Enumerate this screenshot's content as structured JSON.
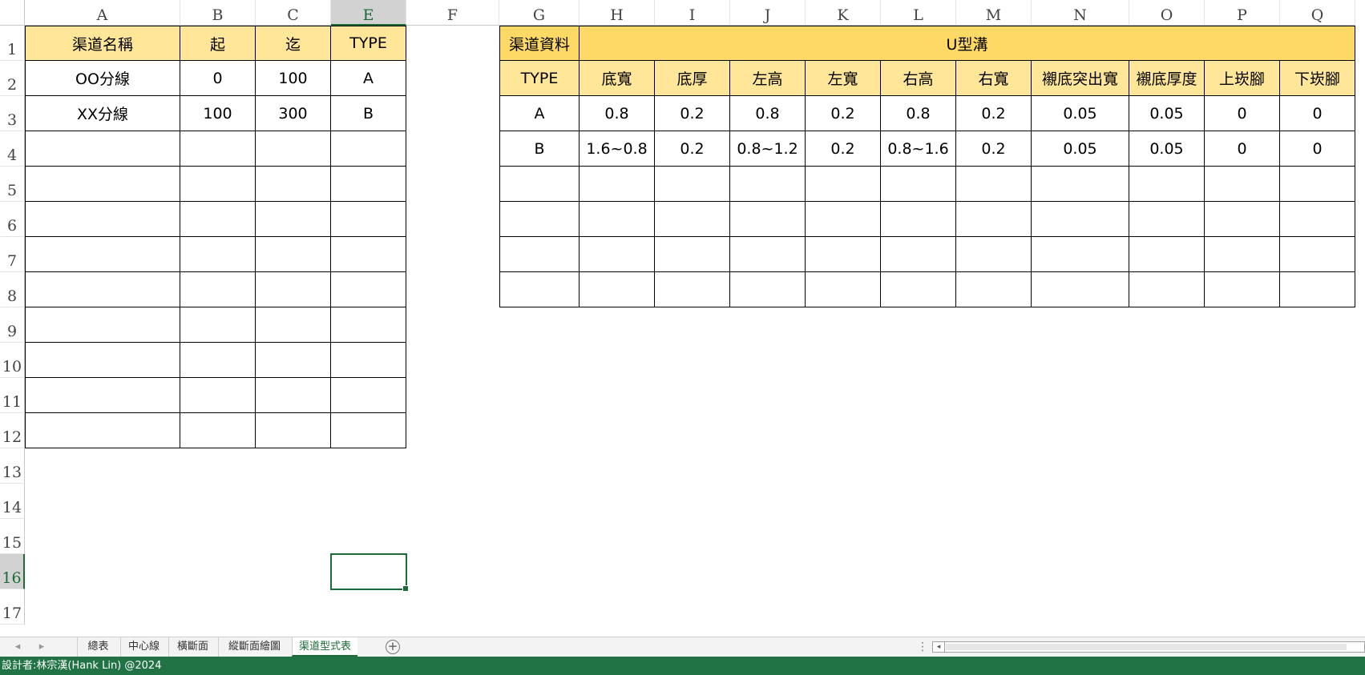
{
  "sheet": {
    "columns": [
      "A",
      "B",
      "C",
      "E",
      "F",
      "G",
      "H",
      "I",
      "J",
      "K",
      "L",
      "M",
      "N",
      "O",
      "P",
      "Q"
    ],
    "selected_column": "E",
    "rows": [
      "1",
      "2",
      "3",
      "4",
      "5",
      "6",
      "7",
      "8",
      "9",
      "10",
      "11",
      "12",
      "13",
      "14",
      "15",
      "16",
      "17"
    ],
    "selected_row": "16",
    "selected_cell": "E16"
  },
  "left_table": {
    "headers": [
      "渠道名稱",
      "起",
      "迄",
      "TYPE"
    ],
    "rows": [
      [
        "OO分線",
        "0",
        "100",
        "A"
      ],
      [
        "XX分線",
        "100",
        "300",
        "B"
      ]
    ]
  },
  "right_table": {
    "title_left": "渠道資料",
    "title_main": "U型溝",
    "headers": [
      "TYPE",
      "底寬",
      "底厚",
      "左高",
      "左寬",
      "右高",
      "右寬",
      "襯底突出寬",
      "襯底厚度",
      "上崁腳",
      "下崁腳"
    ],
    "rows": [
      [
        "A",
        "0.8",
        "0.2",
        "0.8",
        "0.2",
        "0.8",
        "0.2",
        "0.05",
        "0.05",
        "0",
        "0"
      ],
      [
        "B",
        "1.6~0.8",
        "0.2",
        "0.8~1.2",
        "0.2",
        "0.8~1.6",
        "0.2",
        "0.05",
        "0.05",
        "0",
        "0"
      ]
    ]
  },
  "tabs": {
    "items": [
      "總表",
      "中心線",
      "橫斷面",
      "縱斷面繪圖",
      "渠道型式表"
    ],
    "active": "渠道型式表"
  },
  "status": {
    "text": "設計者:林宗漢(Hank Lin) @2024"
  },
  "colors": {
    "header_fill_light": "#ffe699",
    "header_fill_dark": "#ffd966",
    "excel_green": "#217346"
  }
}
